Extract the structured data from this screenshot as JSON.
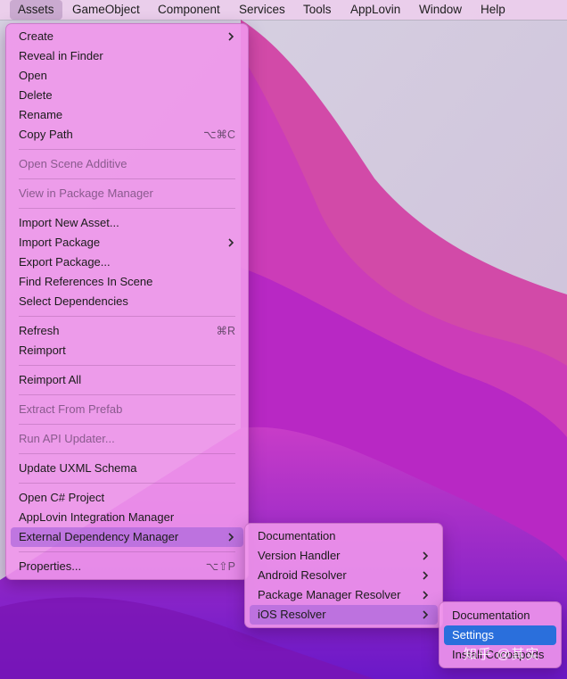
{
  "menubar": {
    "items": [
      "Assets",
      "GameObject",
      "Component",
      "Services",
      "Tools",
      "AppLovin",
      "Window",
      "Help"
    ],
    "active": "Assets"
  },
  "assets_menu": {
    "items": [
      {
        "label": "Create",
        "submenu": true
      },
      {
        "label": "Reveal in Finder"
      },
      {
        "label": "Open"
      },
      {
        "label": "Delete"
      },
      {
        "label": "Rename"
      },
      {
        "label": "Copy Path",
        "shortcut": "⌥⌘C"
      },
      {
        "label": "Open Scene Additive",
        "disabled": true
      },
      {
        "label": "View in Package Manager",
        "disabled": true
      },
      {
        "label": "Import New Asset..."
      },
      {
        "label": "Import Package",
        "submenu": true
      },
      {
        "label": "Export Package..."
      },
      {
        "label": "Find References In Scene"
      },
      {
        "label": "Select Dependencies"
      },
      {
        "label": "Refresh",
        "shortcut": "⌘R"
      },
      {
        "label": "Reimport"
      },
      {
        "label": "Reimport All"
      },
      {
        "label": "Extract From Prefab",
        "disabled": true
      },
      {
        "label": "Run API Updater...",
        "disabled": true
      },
      {
        "label": "Update UXML Schema"
      },
      {
        "label": "Open C# Project"
      },
      {
        "label": "AppLovin Integration Manager"
      },
      {
        "label": "External Dependency Manager",
        "submenu": true,
        "highlighted": true
      },
      {
        "label": "Properties...",
        "shortcut": "⌥⇧P"
      }
    ]
  },
  "edm_menu": {
    "items": [
      {
        "label": "Documentation"
      },
      {
        "label": "Version Handler",
        "submenu": true
      },
      {
        "label": "Android Resolver",
        "submenu": true
      },
      {
        "label": "Package Manager Resolver",
        "submenu": true
      },
      {
        "label": "iOS Resolver",
        "submenu": true,
        "highlighted": true
      }
    ]
  },
  "ios_menu": {
    "items": [
      {
        "label": "Documentation"
      },
      {
        "label": "Settings",
        "selected": true
      },
      {
        "label": "Install Cocoapods"
      }
    ]
  },
  "watermark": "知乎 @其实",
  "colors": {
    "selection": "#2a6fdc",
    "highlight": "#af69dc",
    "menu_bg": "#f096eb"
  }
}
